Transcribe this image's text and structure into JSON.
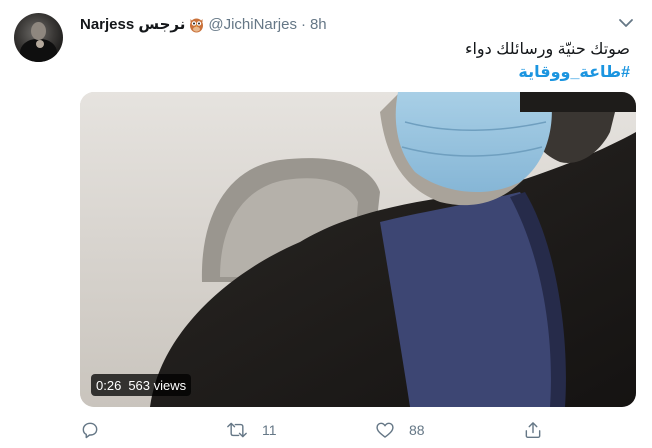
{
  "tweet": {
    "author_name": "Narjess نرجس",
    "author_emoji": "owl-emoji",
    "handle": "@JichiNarjes",
    "separator": "·",
    "time": "8h",
    "text_line": "صوتك حنيّة ورسائلك دواء",
    "hashtag": "#طاعة_ووقاية"
  },
  "video": {
    "duration": "0:26",
    "views": "563 views"
  },
  "actions": {
    "reply_icon": "reply-icon",
    "retweet_icon": "retweet-icon",
    "retweet_count": "11",
    "like_icon": "heart-icon",
    "like_count": "88",
    "share_icon": "share-icon"
  },
  "colors": {
    "text": "#14171a",
    "muted": "#657786",
    "link": "#1b95e0"
  }
}
